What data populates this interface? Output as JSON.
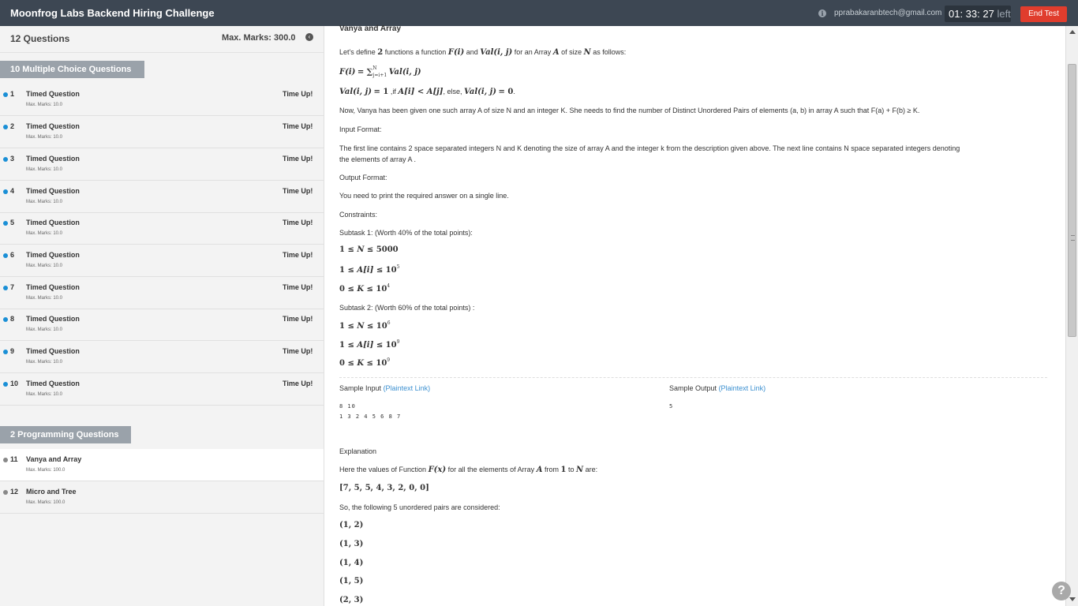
{
  "header": {
    "title": "Moonfrog Labs Backend Hiring Challenge",
    "email": "pprabakaranbtech@gmail.com",
    "timer": "01: 33: 27",
    "timer_suffix": "left",
    "end_test_label": "End Test"
  },
  "sidebar": {
    "question_count": "12 Questions",
    "max_marks": "Max. Marks: 300.0",
    "sections": [
      {
        "title": "10 Multiple Choice Questions",
        "questions": [
          {
            "num": "1",
            "name": "Timed Question",
            "marks": "Max. Marks: 10.0",
            "status": "Time Up!"
          },
          {
            "num": "2",
            "name": "Timed Question",
            "marks": "Max. Marks: 10.0",
            "status": "Time Up!"
          },
          {
            "num": "3",
            "name": "Timed Question",
            "marks": "Max. Marks: 10.0",
            "status": "Time Up!"
          },
          {
            "num": "4",
            "name": "Timed Question",
            "marks": "Max. Marks: 10.0",
            "status": "Time Up!"
          },
          {
            "num": "5",
            "name": "Timed Question",
            "marks": "Max. Marks: 10.0",
            "status": "Time Up!"
          },
          {
            "num": "6",
            "name": "Timed Question",
            "marks": "Max. Marks: 10.0",
            "status": "Time Up!"
          },
          {
            "num": "7",
            "name": "Timed Question",
            "marks": "Max. Marks: 10.0",
            "status": "Time Up!"
          },
          {
            "num": "8",
            "name": "Timed Question",
            "marks": "Max. Marks: 10.0",
            "status": "Time Up!"
          },
          {
            "num": "9",
            "name": "Timed Question",
            "marks": "Max. Marks: 10.0",
            "status": "Time Up!"
          },
          {
            "num": "10",
            "name": "Timed Question",
            "marks": "Max. Marks: 10.0",
            "status": "Time Up!"
          }
        ]
      },
      {
        "title": "2 Programming Questions",
        "questions": [
          {
            "num": "11",
            "name": "Vanya and Array",
            "marks": "Max. Marks: 100.0",
            "status": ""
          },
          {
            "num": "12",
            "name": "Micro and Tree",
            "marks": "Max. Marks: 100.0",
            "status": ""
          }
        ]
      }
    ]
  },
  "problem": {
    "title": "Vanya and Array",
    "intro_1": "Let's define",
    "intro_2": "functions a function",
    "intro_3": "and",
    "intro_4": "for an Array",
    "intro_5": "of size",
    "intro_6": "as follows:",
    "now_text": "Now, Vanya has been given one such array A of size N and an integer K. She needs to find the number of Distinct Unordered Pairs of elements (a, b) in array A such that F(a) + F(b) ≥ K.",
    "input_format_label": "Input Format:",
    "input_format_text_1": "The first line contains 2 space separated integers N and K denoting the size of array A and the integer k from the description given above. The next line contains N space separated integers denoting",
    "input_format_text_2": "the elements of array A .",
    "output_format_label": "Output Format:",
    "output_format_text": "You need to print the required answer on a single line.",
    "constraints_label": "Constraints:",
    "subtask1": "Subtask 1: (Worth 40% of the total points):",
    "subtask2": "Subtask 2: (Worth 60% of the total points) :",
    "sample_input_label": "Sample Input",
    "sample_output_label": "Sample Output",
    "plaintext_link": "(Plaintext Link)",
    "sample_input_line1": "8 10",
    "sample_input_line2": "1 3 2 4 5 6 8 7",
    "sample_output": "5",
    "explanation_label": "Explanation",
    "explanation_text_1": "Here the values of Function",
    "explanation_text_2": "for all the elements of Array",
    "explanation_text_3": "from",
    "explanation_text_4": "to",
    "explanation_text_5": "are:",
    "values_list": "[7, 5, 5, 4, 3, 2, 0, 0]",
    "pairs_text": "So, the following 5 unordered pairs are considered:",
    "pairs": [
      "(1, 2)",
      "(1, 3)",
      "(1, 4)",
      "(1, 5)",
      "(2, 3)"
    ]
  },
  "help_label": "?"
}
